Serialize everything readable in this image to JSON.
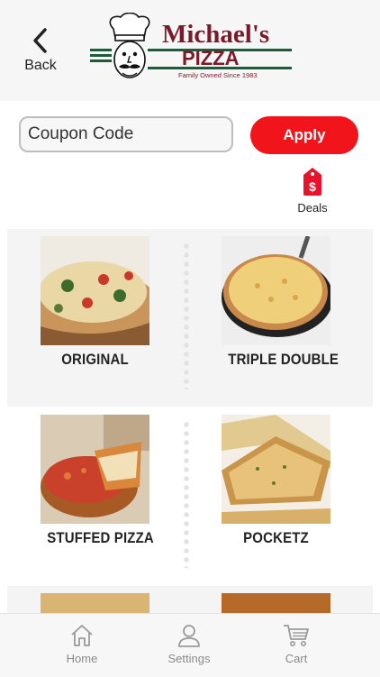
{
  "header": {
    "back_label": "Back",
    "logo": {
      "name_line1": "Michael's",
      "name_line2": "PIZZA",
      "tagline": "Family Owned Since 1983",
      "brand_color": "#7b1a2a",
      "stripe_color": "#1f5a3a"
    }
  },
  "coupon": {
    "placeholder": "Coupon Code",
    "apply_label": "Apply"
  },
  "deals": {
    "label": "Deals",
    "icon": "price-tag-dollar-icon"
  },
  "menu": {
    "items": [
      {
        "label": "ORIGINAL",
        "photo": "original-pizza-slice-photo"
      },
      {
        "label": "TRIPLE DOUBLE",
        "photo": "triple-double-cheese-pizza-photo"
      },
      {
        "label": "STUFFED PIZZA",
        "photo": "stuffed-pizza-photo"
      },
      {
        "label": "POCKETZ",
        "photo": "pocketz-bread-photo"
      }
    ]
  },
  "tabs": [
    {
      "label": "Home",
      "icon": "home-icon"
    },
    {
      "label": "Settings",
      "icon": "user-icon"
    },
    {
      "label": "Cart",
      "icon": "cart-icon"
    }
  ],
  "colors": {
    "accent": "#f1141a",
    "tab_inactive": "#8a8a8a"
  }
}
